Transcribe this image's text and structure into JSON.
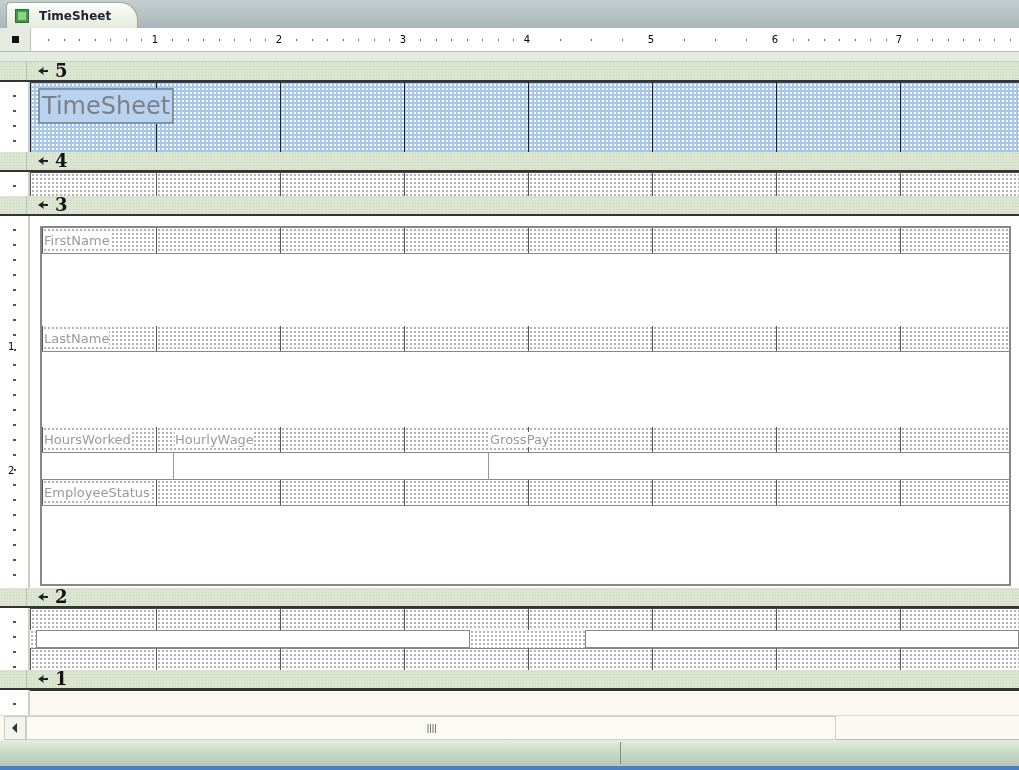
{
  "tab": {
    "title": "TimeSheet"
  },
  "ruler": {
    "labels": [
      "1",
      "2",
      "3",
      "4",
      "5",
      "6",
      "7"
    ]
  },
  "vertical_ruler": {
    "labels": [
      "1",
      "2"
    ]
  },
  "sections": [
    {
      "number": "5",
      "selected": true,
      "kind": "title",
      "title_label": "TimeSheet"
    },
    {
      "number": "4",
      "selected": false,
      "kind": "strip"
    },
    {
      "number": "3",
      "selected": false,
      "kind": "detail",
      "rows": [
        {
          "kind": "labels",
          "labels": [
            "FirstName"
          ]
        },
        {
          "kind": "blank"
        },
        {
          "kind": "labels",
          "labels": [
            "LastName"
          ]
        },
        {
          "kind": "blank"
        },
        {
          "kind": "labels",
          "labels": [
            "HoursWorked",
            "HourlyWage",
            "GrossPay"
          ]
        },
        {
          "kind": "fields"
        },
        {
          "kind": "labels",
          "labels": [
            "EmployeeStatus"
          ]
        },
        {
          "kind": "blank"
        }
      ]
    },
    {
      "number": "2",
      "selected": false,
      "kind": "boxes"
    },
    {
      "number": "1",
      "selected": false,
      "kind": "empty"
    }
  ]
}
